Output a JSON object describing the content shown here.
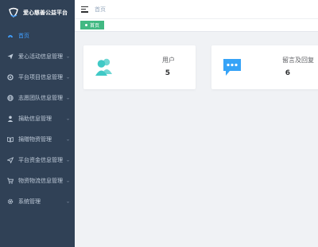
{
  "app": {
    "title": "爱心慈善公益平台"
  },
  "sidebar": {
    "items": [
      {
        "label": "首页",
        "icon": "dashboard-icon",
        "active": true,
        "has_children": false
      },
      {
        "label": "爱心活动信息管理",
        "icon": "send-icon",
        "active": false,
        "has_children": true
      },
      {
        "label": "平台项目信息管理",
        "icon": "target-icon",
        "active": false,
        "has_children": true
      },
      {
        "label": "志愿团队信息管理",
        "icon": "globe-icon",
        "active": false,
        "has_children": true
      },
      {
        "label": "捐助信息管理",
        "icon": "person-icon",
        "active": false,
        "has_children": true
      },
      {
        "label": "捐赠物资管理",
        "icon": "book-icon",
        "active": false,
        "has_children": true
      },
      {
        "label": "平台资金信息管理",
        "icon": "plane-icon",
        "active": false,
        "has_children": true
      },
      {
        "label": "物资物流信息管理",
        "icon": "cart-icon",
        "active": false,
        "has_children": true
      },
      {
        "label": "系统管理",
        "icon": "gear-icon",
        "active": false,
        "has_children": true
      }
    ]
  },
  "header": {
    "breadcrumb": "首页"
  },
  "tags": {
    "active_label": "首页"
  },
  "dashboard": {
    "users": {
      "label": "用户",
      "value": "5",
      "icon": "users-icon",
      "color": "#40c9c6"
    },
    "messages": {
      "label": "留言及回复",
      "value": "6",
      "icon": "message-icon",
      "color": "#36a3f7"
    }
  },
  "colors": {
    "sidebar_bg": "#304156",
    "active_menu": "#409eff",
    "tag_bg": "#42b983"
  }
}
